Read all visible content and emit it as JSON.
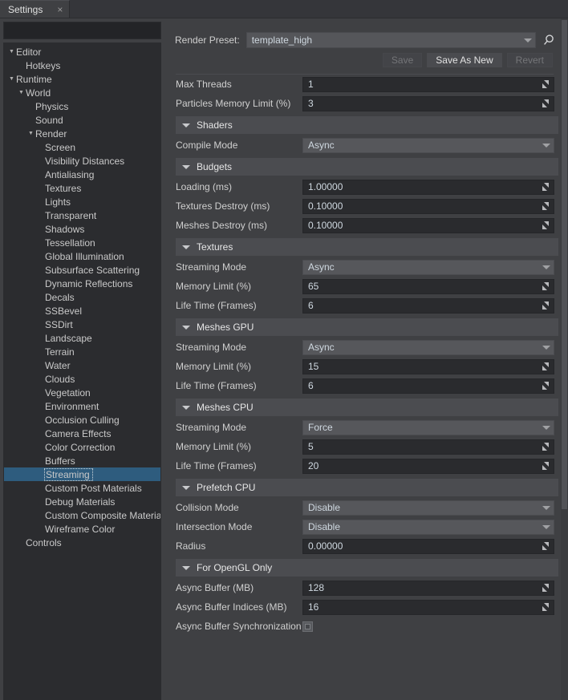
{
  "window": {
    "tab_label": "Settings",
    "tab_close": "×"
  },
  "sidebar": {
    "search_placeholder": "",
    "search_value": "",
    "items": [
      {
        "label": "Editor",
        "depth": 0,
        "arrow": "expanded",
        "selected": false
      },
      {
        "label": "Hotkeys",
        "depth": 1,
        "arrow": "none",
        "selected": false
      },
      {
        "label": "Runtime",
        "depth": 0,
        "arrow": "expanded",
        "selected": false
      },
      {
        "label": "World",
        "depth": 1,
        "arrow": "expanded",
        "selected": false
      },
      {
        "label": "Physics",
        "depth": 2,
        "arrow": "none",
        "selected": false
      },
      {
        "label": "Sound",
        "depth": 2,
        "arrow": "none",
        "selected": false
      },
      {
        "label": "Render",
        "depth": 2,
        "arrow": "expanded",
        "selected": false
      },
      {
        "label": "Screen",
        "depth": 3,
        "arrow": "none",
        "selected": false
      },
      {
        "label": "Visibility Distances",
        "depth": 3,
        "arrow": "none",
        "selected": false
      },
      {
        "label": "Antialiasing",
        "depth": 3,
        "arrow": "none",
        "selected": false
      },
      {
        "label": "Textures",
        "depth": 3,
        "arrow": "none",
        "selected": false
      },
      {
        "label": "Lights",
        "depth": 3,
        "arrow": "none",
        "selected": false
      },
      {
        "label": "Transparent",
        "depth": 3,
        "arrow": "none",
        "selected": false
      },
      {
        "label": "Shadows",
        "depth": 3,
        "arrow": "none",
        "selected": false
      },
      {
        "label": "Tessellation",
        "depth": 3,
        "arrow": "none",
        "selected": false
      },
      {
        "label": "Global Illumination",
        "depth": 3,
        "arrow": "none",
        "selected": false
      },
      {
        "label": "Subsurface Scattering",
        "depth": 3,
        "arrow": "none",
        "selected": false
      },
      {
        "label": "Dynamic Reflections",
        "depth": 3,
        "arrow": "none",
        "selected": false
      },
      {
        "label": "Decals",
        "depth": 3,
        "arrow": "none",
        "selected": false
      },
      {
        "label": "SSBevel",
        "depth": 3,
        "arrow": "none",
        "selected": false
      },
      {
        "label": "SSDirt",
        "depth": 3,
        "arrow": "none",
        "selected": false
      },
      {
        "label": "Landscape",
        "depth": 3,
        "arrow": "none",
        "selected": false
      },
      {
        "label": "Terrain",
        "depth": 3,
        "arrow": "none",
        "selected": false
      },
      {
        "label": "Water",
        "depth": 3,
        "arrow": "none",
        "selected": false
      },
      {
        "label": "Clouds",
        "depth": 3,
        "arrow": "none",
        "selected": false
      },
      {
        "label": "Vegetation",
        "depth": 3,
        "arrow": "none",
        "selected": false
      },
      {
        "label": "Environment",
        "depth": 3,
        "arrow": "none",
        "selected": false
      },
      {
        "label": "Occlusion Culling",
        "depth": 3,
        "arrow": "none",
        "selected": false
      },
      {
        "label": "Camera Effects",
        "depth": 3,
        "arrow": "none",
        "selected": false
      },
      {
        "label": "Color Correction",
        "depth": 3,
        "arrow": "none",
        "selected": false
      },
      {
        "label": "Buffers",
        "depth": 3,
        "arrow": "none",
        "selected": false
      },
      {
        "label": "Streaming",
        "depth": 3,
        "arrow": "none",
        "selected": true
      },
      {
        "label": "Custom Post Materials",
        "depth": 3,
        "arrow": "none",
        "selected": false
      },
      {
        "label": "Debug Materials",
        "depth": 3,
        "arrow": "none",
        "selected": false
      },
      {
        "label": "Custom Composite Materials",
        "depth": 3,
        "arrow": "none",
        "selected": false
      },
      {
        "label": "Wireframe Color",
        "depth": 3,
        "arrow": "none",
        "selected": false
      },
      {
        "label": "Controls",
        "depth": 1,
        "arrow": "none",
        "selected": false
      }
    ]
  },
  "preset": {
    "label": "Render Preset:",
    "value": "template_high",
    "search_icon": "magnifier-icon",
    "caret_icon": "chevron-down-icon"
  },
  "buttons": {
    "save": {
      "label": "Save",
      "enabled": false
    },
    "save_as_new": {
      "label": "Save As New",
      "enabled": true
    },
    "revert": {
      "label": "Revert",
      "enabled": false
    }
  },
  "top_fields": [
    {
      "label": "Max Threads",
      "value": "1",
      "type": "number"
    },
    {
      "label": "Particles Memory Limit (%)",
      "value": "3",
      "type": "number"
    }
  ],
  "sections": [
    {
      "title": "Shaders",
      "fields": [
        {
          "label": "Compile Mode",
          "value": "Async",
          "type": "combo"
        }
      ]
    },
    {
      "title": "Budgets",
      "fields": [
        {
          "label": "Loading (ms)",
          "value": "1.00000",
          "type": "number"
        },
        {
          "label": "Textures Destroy (ms)",
          "value": "0.10000",
          "type": "number"
        },
        {
          "label": "Meshes Destroy (ms)",
          "value": "0.10000",
          "type": "number"
        }
      ]
    },
    {
      "title": "Textures",
      "fields": [
        {
          "label": "Streaming Mode",
          "value": "Async",
          "type": "combo"
        },
        {
          "label": "Memory Limit (%)",
          "value": "65",
          "type": "number"
        },
        {
          "label": "Life Time (Frames)",
          "value": "6",
          "type": "number"
        }
      ]
    },
    {
      "title": "Meshes GPU",
      "fields": [
        {
          "label": "Streaming Mode",
          "value": "Async",
          "type": "combo"
        },
        {
          "label": "Memory Limit (%)",
          "value": "15",
          "type": "number"
        },
        {
          "label": "Life Time (Frames)",
          "value": "6",
          "type": "number"
        }
      ]
    },
    {
      "title": "Meshes CPU",
      "fields": [
        {
          "label": "Streaming Mode",
          "value": "Force",
          "type": "combo"
        },
        {
          "label": "Memory Limit (%)",
          "value": "5",
          "type": "number"
        },
        {
          "label": "Life Time (Frames)",
          "value": "20",
          "type": "number"
        }
      ]
    },
    {
      "title": "Prefetch CPU",
      "fields": [
        {
          "label": "Collision Mode",
          "value": "Disable",
          "type": "combo"
        },
        {
          "label": "Intersection Mode",
          "value": "Disable",
          "type": "combo"
        },
        {
          "label": "Radius",
          "value": "0.00000",
          "type": "number"
        }
      ]
    },
    {
      "title": "For OpenGL Only",
      "fields": [
        {
          "label": "Async Buffer (MB)",
          "value": "128",
          "type": "number"
        },
        {
          "label": "Async Buffer Indices (MB)",
          "value": "16",
          "type": "number"
        },
        {
          "label": "Async Buffer Synchronization",
          "value": "",
          "type": "checkbox",
          "checked": false
        }
      ]
    }
  ],
  "colors": {
    "background": "#3f4043",
    "panel": "#2b2c2f",
    "selection": "#2e5c7e",
    "section_header": "#4b4c50",
    "field_bg": "#2a2b2e",
    "combo_bg": "#56575b",
    "text": "#cfcfcf",
    "value_text": "#cfd8e0"
  }
}
